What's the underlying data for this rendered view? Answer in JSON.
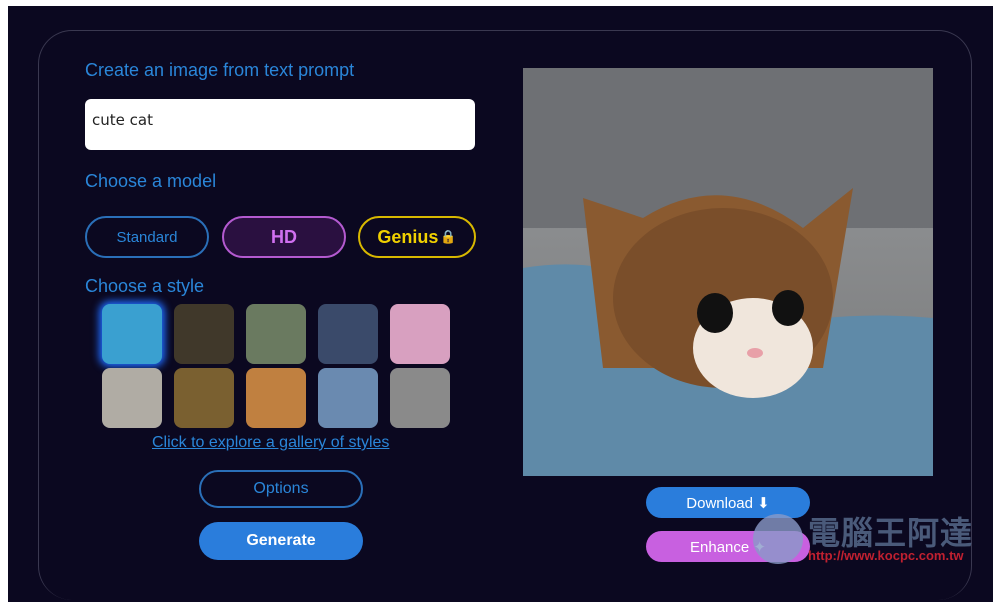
{
  "heading_prompt": "Create an image from text prompt",
  "prompt_value": "cute cat",
  "heading_model": "Choose a model",
  "models": [
    {
      "label": "Standard"
    },
    {
      "label": "HD"
    },
    {
      "label": "Genius"
    }
  ],
  "lock_icon": "lock-icon",
  "heading_style": "Choose a style",
  "styles": [
    {
      "name": "abstract-paint",
      "color": "#3aa0d0",
      "selected": true
    },
    {
      "name": "panda",
      "color": "#40382a"
    },
    {
      "name": "landscape",
      "color": "#6a7a60"
    },
    {
      "name": "robot",
      "color": "#3a4a6a"
    },
    {
      "name": "anime-girl",
      "color": "#d8a0c0"
    },
    {
      "name": "pencil-car",
      "color": "#b0aca4"
    },
    {
      "name": "mona-lisa",
      "color": "#7a6030"
    },
    {
      "name": "flowers",
      "color": "#c08040"
    },
    {
      "name": "ballet",
      "color": "#6a8ab0"
    },
    {
      "name": "sketch-city",
      "color": "#8a8a8a"
    }
  ],
  "gallery_link": "Click to explore a gallery of styles",
  "options_label": "Options",
  "generate_label": "Generate",
  "download_label": "Download ⬇",
  "enhance_label": "Enhance ✦",
  "watermark": {
    "title": "電腦王阿達",
    "url": "http://www.kocpc.com.tw"
  }
}
